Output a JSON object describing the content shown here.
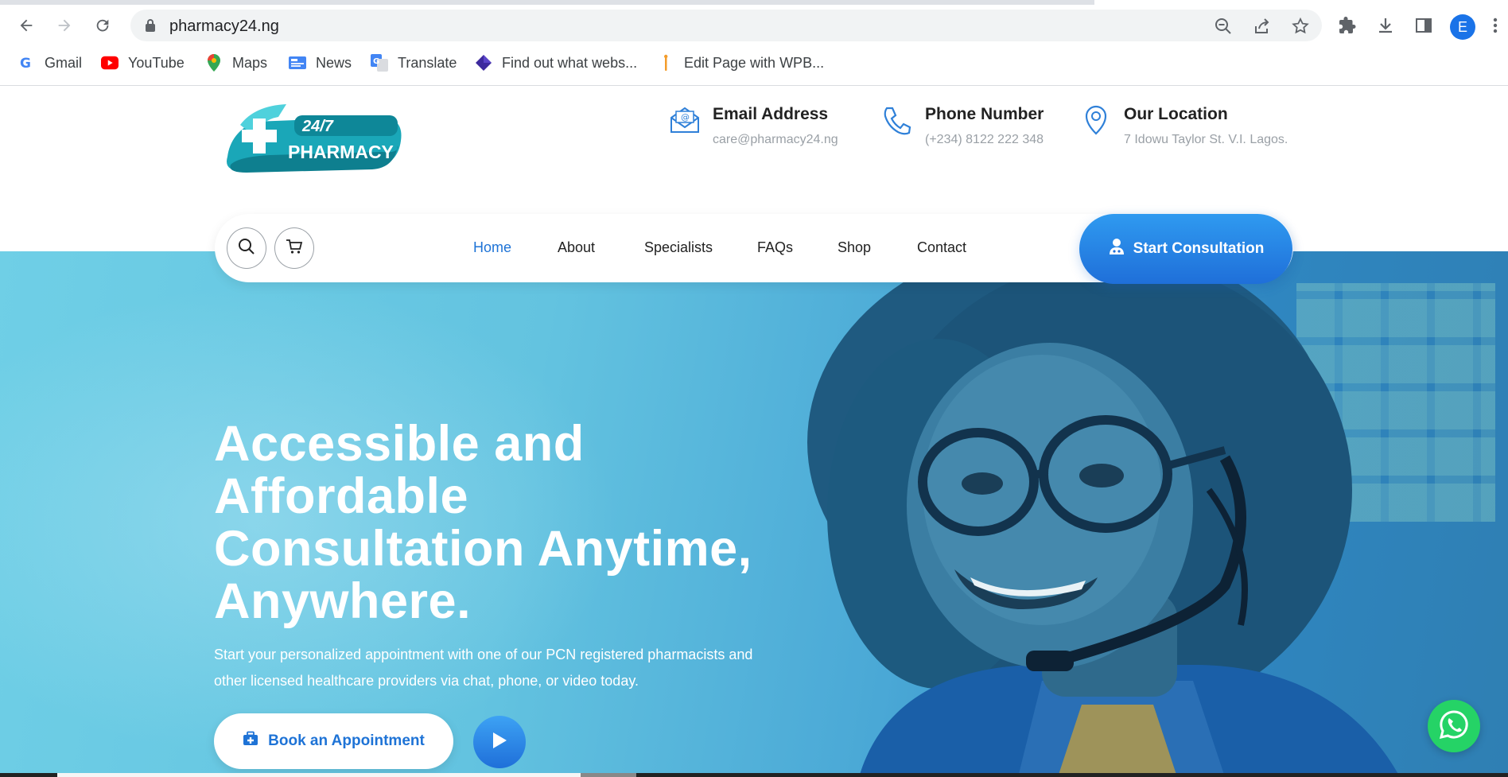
{
  "browser": {
    "url": "pharmacy24.ng",
    "profile_initial": "E",
    "bookmarks": [
      {
        "label": "Gmail",
        "icon": "gmail-icon"
      },
      {
        "label": "YouTube",
        "icon": "youtube-icon"
      },
      {
        "label": "Maps",
        "icon": "maps-icon"
      },
      {
        "label": "News",
        "icon": "news-icon"
      },
      {
        "label": "Translate",
        "icon": "translate-icon"
      },
      {
        "label": "Find out what webs...",
        "icon": "diamond-icon"
      },
      {
        "label": "Edit Page with WPB...",
        "icon": "wpbakery-icon"
      }
    ]
  },
  "site": {
    "logo": {
      "line1": "24/7",
      "line2": "PHARMACY"
    },
    "contacts": [
      {
        "title": "Email Address",
        "value": "care@pharmacy24.ng",
        "icon": "email-icon"
      },
      {
        "title": "Phone Number",
        "value": "(+234) 8122 222 348",
        "icon": "phone-icon"
      },
      {
        "title": "Our Location",
        "value": "7 Idowu Taylor St. V.I. Lagos.",
        "icon": "location-pin-icon"
      }
    ],
    "nav": {
      "links": [
        "Home",
        "About",
        "Specialists",
        "FAQs",
        "Shop",
        "Contact"
      ],
      "active": "Home",
      "cta": "Start Consultation"
    },
    "hero": {
      "headline": "Accessible and Affordable Consultation Anytime, Anywhere.",
      "subtext": "Start your personalized appointment with one of our PCN registered pharmacists and other licensed healthcare providers via chat, phone, or video today.",
      "book_button": "Book an Appointment"
    }
  },
  "colors": {
    "accent": "#1e73d6",
    "hero": "#5fc0e0",
    "whatsapp": "#25d366"
  }
}
